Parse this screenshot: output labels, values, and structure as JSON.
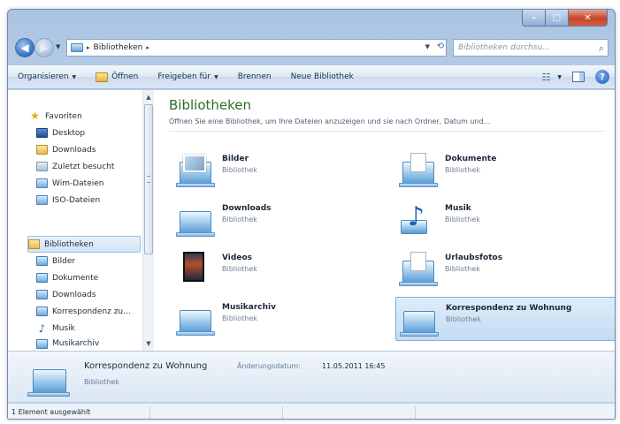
{
  "window": {
    "caption": {
      "minimize": "–",
      "maximize": "□",
      "close": "✕"
    }
  },
  "nav": {
    "back_glyph": "◀",
    "forward_glyph": "▶"
  },
  "address": {
    "path_separator": "▸",
    "crumb": "Bibliotheken",
    "refresh_glyph": "⟲"
  },
  "search": {
    "placeholder": "Bibliotheken durchsu...",
    "icon_glyph": "⌕"
  },
  "toolbar": {
    "organize": "Organisieren",
    "open": "Öffnen",
    "share": "Freigeben für",
    "burn": "Brennen",
    "new_library": "Neue Bibliothek",
    "help_glyph": "?"
  },
  "sidebar": {
    "favorites": "Favoriten",
    "fav_items": [
      "Desktop",
      "Downloads",
      "Zuletzt besucht",
      "Wim-Dateien",
      "ISO-Dateien"
    ],
    "libraries": "Bibliotheken",
    "lib_items": [
      "Bilder",
      "Dokumente",
      "Downloads",
      "Korrespondenz zu...",
      "Musik",
      "Musikarchiv"
    ]
  },
  "content": {
    "title": "Bibliotheken",
    "subtitle": "Öffnen Sie eine Bibliothek, um Ihre Dateien anzuzeigen und sie nach Ordner, Datum und...",
    "libraries": [
      {
        "name": "Bilder",
        "type": "Bibliothek",
        "icon": "pictures-library-icon"
      },
      {
        "name": "Dokumente",
        "type": "Bibliothek",
        "icon": "documents-library-icon"
      },
      {
        "name": "Downloads",
        "type": "Bibliothek",
        "icon": "downloads-library-icon"
      },
      {
        "name": "Musik",
        "type": "Bibliothek",
        "icon": "music-library-icon"
      },
      {
        "name": "Videos",
        "type": "Bibliothek",
        "icon": "videos-library-icon"
      },
      {
        "name": "Urlaubsfotos",
        "type": "Bibliothek",
        "icon": "photos-library-icon"
      },
      {
        "name": "Musikarchiv",
        "type": "Bibliothek",
        "icon": "library-icon"
      },
      {
        "name": "Korrespondenz zu Wohnung",
        "type": "Bibliothek",
        "icon": "library-icon",
        "selected": true
      }
    ]
  },
  "details": {
    "name": "Korrespondenz zu Wohnung",
    "date_label": "Änderungsdatum:",
    "date_value": "11.05.2011 16:45",
    "type": "Bibliothek"
  },
  "status": {
    "text": "1 Element ausgewählt"
  }
}
